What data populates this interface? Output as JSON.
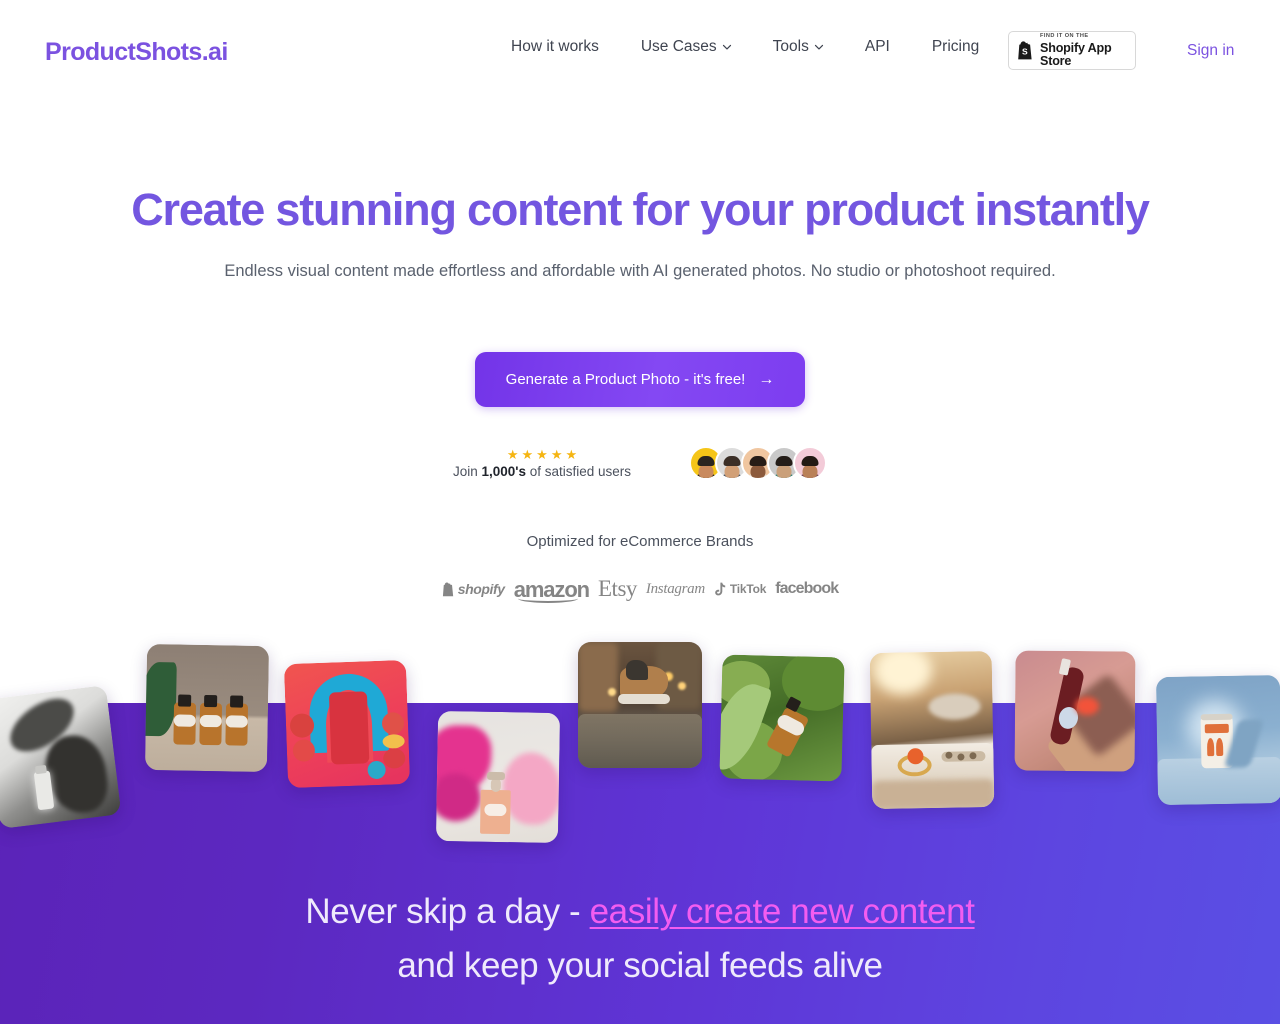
{
  "brand": {
    "logo_text": "ProductShots.ai",
    "accent_purple": "#7356e0",
    "cta_purple": "#7c3aed",
    "band_purple": "#5f2fd0",
    "highlight_pink": "#f35df0",
    "star_yellow": "#f5b512"
  },
  "nav": {
    "items": [
      {
        "label": "How it works",
        "has_caret": false
      },
      {
        "label": "Use Cases",
        "has_caret": true
      },
      {
        "label": "Tools",
        "has_caret": true
      },
      {
        "label": "API",
        "has_caret": false
      },
      {
        "label": "Pricing",
        "has_caret": false
      }
    ],
    "shopify_badge": {
      "kicker": "FIND IT ON THE",
      "title": "Shopify App Store"
    },
    "signin_label": "Sign in"
  },
  "hero": {
    "headline": "Create stunning content for your product instantly",
    "subheadline": "Endless visual content made effortless and affordable with AI generated photos. No studio or photoshoot required.",
    "cta_label": "Generate a Product Photo - it's free!",
    "cta_arrow": "→"
  },
  "social_proof": {
    "stars": "★★★★★",
    "star_count": 5,
    "join_prefix": "Join ",
    "join_bold": "1,000's",
    "join_suffix": " of satisfied users",
    "avatars": [
      {
        "name": "avatar-1",
        "bg": "#f5c518",
        "skin": "#c98a5e",
        "hair": "#2a2520",
        "shirt": "#1f1c19"
      },
      {
        "name": "avatar-2",
        "bg": "#dcdcdc",
        "skin": "#d2a077",
        "hair": "#3b2f27",
        "shirt": "#3f4a58"
      },
      {
        "name": "avatar-3",
        "bg": "#f0c6a0",
        "skin": "#8c5a3c",
        "hair": "#271c16",
        "shirt": "#e8e3dc"
      },
      {
        "name": "avatar-4",
        "bg": "#c9c9c9",
        "skin": "#caa07a",
        "hair": "#241d18",
        "shirt": "#2e7d6e"
      },
      {
        "name": "avatar-5",
        "bg": "#f3cbd8",
        "skin": "#b98057",
        "hair": "#221a14",
        "shirt": "#6b3b4c"
      }
    ]
  },
  "brands": {
    "title": "Optimized for eCommerce Brands",
    "logos": [
      {
        "name": "shopify-logo",
        "label": "shopify"
      },
      {
        "name": "amazon-logo",
        "label": "amazon"
      },
      {
        "name": "etsy-logo",
        "label": "Etsy"
      },
      {
        "name": "instagram-logo",
        "label": "Instagram"
      },
      {
        "name": "tiktok-logo",
        "label": "TikTok"
      },
      {
        "name": "facebook-logo",
        "label": "facebook"
      }
    ]
  },
  "gallery": {
    "shots": [
      {
        "name": "shot-serum-bw",
        "alt": "Serum bottle in black and white abstract scene"
      },
      {
        "name": "shot-amber-bottles",
        "alt": "Three amber pump bottles on tan shelf"
      },
      {
        "name": "shot-red-pouch",
        "alt": "Red drink pouch on coral background with arch"
      },
      {
        "name": "shot-perfume-smoke",
        "alt": "Perfume bottle with pink smoke"
      },
      {
        "name": "shot-sneaker-city",
        "alt": "Sneaker floating on wet city street at night"
      },
      {
        "name": "shot-dropper-moss",
        "alt": "Dropper bottle on green moss"
      },
      {
        "name": "shot-ring-sunlit",
        "alt": "Gold ring with orange stone in sunlight"
      },
      {
        "name": "shot-wine-bottle",
        "alt": "Wine bottle on pink and tan backdrop"
      },
      {
        "name": "shot-soda-can",
        "alt": "Soda can on blue pedestal"
      }
    ]
  },
  "bottom": {
    "line1_prefix": "Never skip a day - ",
    "line1_highlight": "easily create new content",
    "line2": "and keep your social feeds alive"
  }
}
